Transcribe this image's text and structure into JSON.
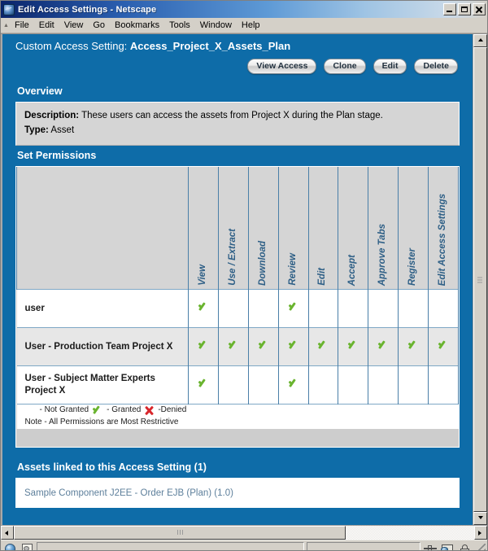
{
  "window": {
    "title": "Edit Access Settings - Netscape",
    "app_icon": "netscape-icon",
    "minimize_label": "Minimize",
    "maximize_label": "Maximize",
    "close_label": "Close"
  },
  "menubar": {
    "items": [
      {
        "label": "File"
      },
      {
        "label": "Edit"
      },
      {
        "label": "View"
      },
      {
        "label": "Go"
      },
      {
        "label": "Bookmarks"
      },
      {
        "label": "Tools"
      },
      {
        "label": "Window"
      },
      {
        "label": "Help"
      }
    ]
  },
  "page": {
    "header_prefix": "Custom Access Setting:",
    "header_name": "Access_Project_X_Assets_Plan",
    "actions": [
      {
        "label": "View Access"
      },
      {
        "label": "Clone"
      },
      {
        "label": "Edit"
      },
      {
        "label": "Delete"
      }
    ],
    "overview": {
      "heading": "Overview",
      "description_label": "Description:",
      "description_value": "These users can access the assets from Project X during the Plan stage.",
      "type_label": "Type:",
      "type_value": "Asset"
    },
    "permissions": {
      "heading": "Set Permissions",
      "columns": [
        "View",
        "Use / Extract",
        "Download",
        "Review",
        "Edit",
        "Accept",
        "Approve Tabs",
        "Register",
        "Edit Access Settings"
      ],
      "rows": [
        {
          "name": "user",
          "values": [
            "granted",
            "none",
            "none",
            "granted",
            "none",
            "none",
            "none",
            "none",
            "none"
          ]
        },
        {
          "name": "User - Production Team Project X",
          "values": [
            "granted",
            "granted",
            "granted",
            "granted",
            "granted",
            "granted",
            "granted",
            "granted",
            "granted"
          ]
        },
        {
          "name": "User - Subject Matter Experts Project X",
          "values": [
            "granted",
            "none",
            "none",
            "granted",
            "none",
            "none",
            "none",
            "none",
            "none"
          ]
        }
      ],
      "legend": {
        "not_granted": "- Not Granted",
        "granted": "- Granted",
        "denied": "-Denied"
      },
      "note": "Note - All Permissions are Most Restrictive"
    },
    "assets": {
      "heading": "Assets linked to this Access Setting (1)",
      "items": [
        {
          "label": "Sample Component J2EE - Order EJB (Plan) (1.0)"
        }
      ]
    }
  },
  "statusbar": {
    "icons": [
      "globe-icon",
      "document-icon"
    ],
    "right_icons": [
      "plug-icon",
      "shield-icon",
      "lock-icon"
    ],
    "text": ""
  },
  "colors": {
    "panel_blue": "#0e6ca8",
    "title_blue": "#0a246a",
    "granted_green": "#6ab42f",
    "denied_red": "#d8272c",
    "column_label_blue": "#2e5f86",
    "link_blue": "#5d7f9b"
  }
}
